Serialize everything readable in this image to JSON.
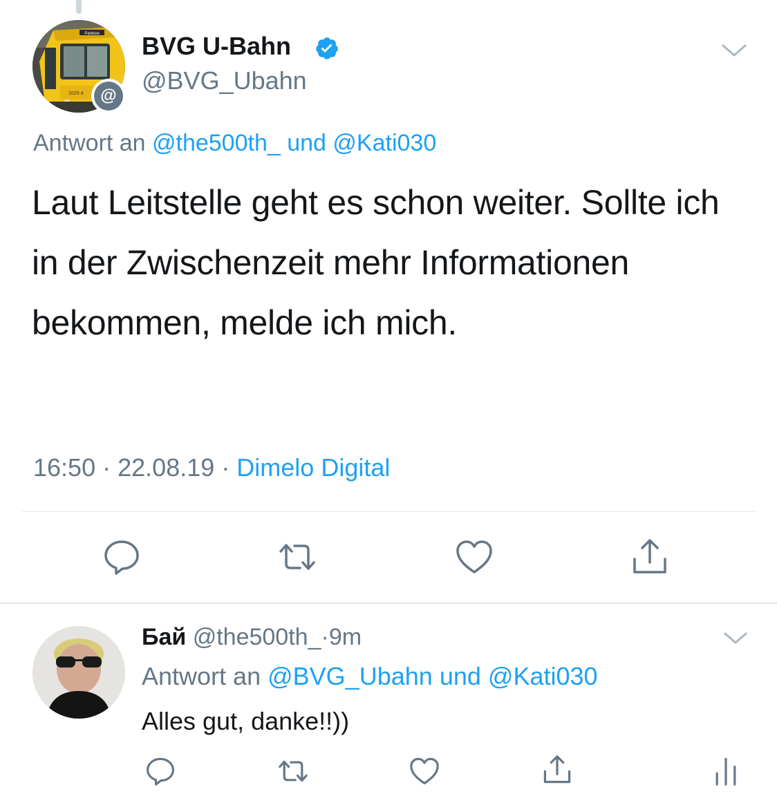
{
  "tweet": {
    "author": {
      "display_name": "BVG U-Bahn",
      "handle": "@BVG_Ubahn",
      "verified": true,
      "avatar_icon": "subway-train-avatar",
      "avatar_badge": "@",
      "avatar_train_label": "Pankow",
      "avatar_train_number": "1025-4"
    },
    "reply_to": {
      "prefix": "Antwort an",
      "user1": "@the500th_",
      "conjunction": "und",
      "user2": "@Kati030"
    },
    "text": "Laut Leitstelle geht es schon weiter. Sollte ich in der Zwischenzeit mehr Informationen bekommen, melde ich mich.",
    "time": "16:50",
    "date": "22.08.19",
    "separator": "·",
    "source": "Dimelo Digital",
    "actions": {
      "reply_icon": "reply-icon",
      "retweet_icon": "retweet-icon",
      "like_icon": "heart-icon",
      "share_icon": "share-icon"
    }
  },
  "reply": {
    "display_name": "Бай",
    "handle": "@the500th_",
    "separator": "·",
    "age": "9m",
    "avatar_icon": "user-avatar",
    "reply_to": {
      "prefix": "Antwort an",
      "user1": "@BVG_Ubahn",
      "conjunction": "und",
      "user2": "@Kati030"
    },
    "text": "Alles gut, danke!!))",
    "actions": {
      "reply_icon": "reply-icon",
      "retweet_icon": "retweet-icon",
      "like_icon": "heart-icon",
      "share_icon": "share-icon",
      "analytics_icon": "analytics-icon"
    }
  },
  "colors": {
    "link": "#1da1f2",
    "secondary_text": "#657786",
    "primary_text": "#14171a",
    "divider": "#e1e8ed",
    "icon": "#657786"
  }
}
